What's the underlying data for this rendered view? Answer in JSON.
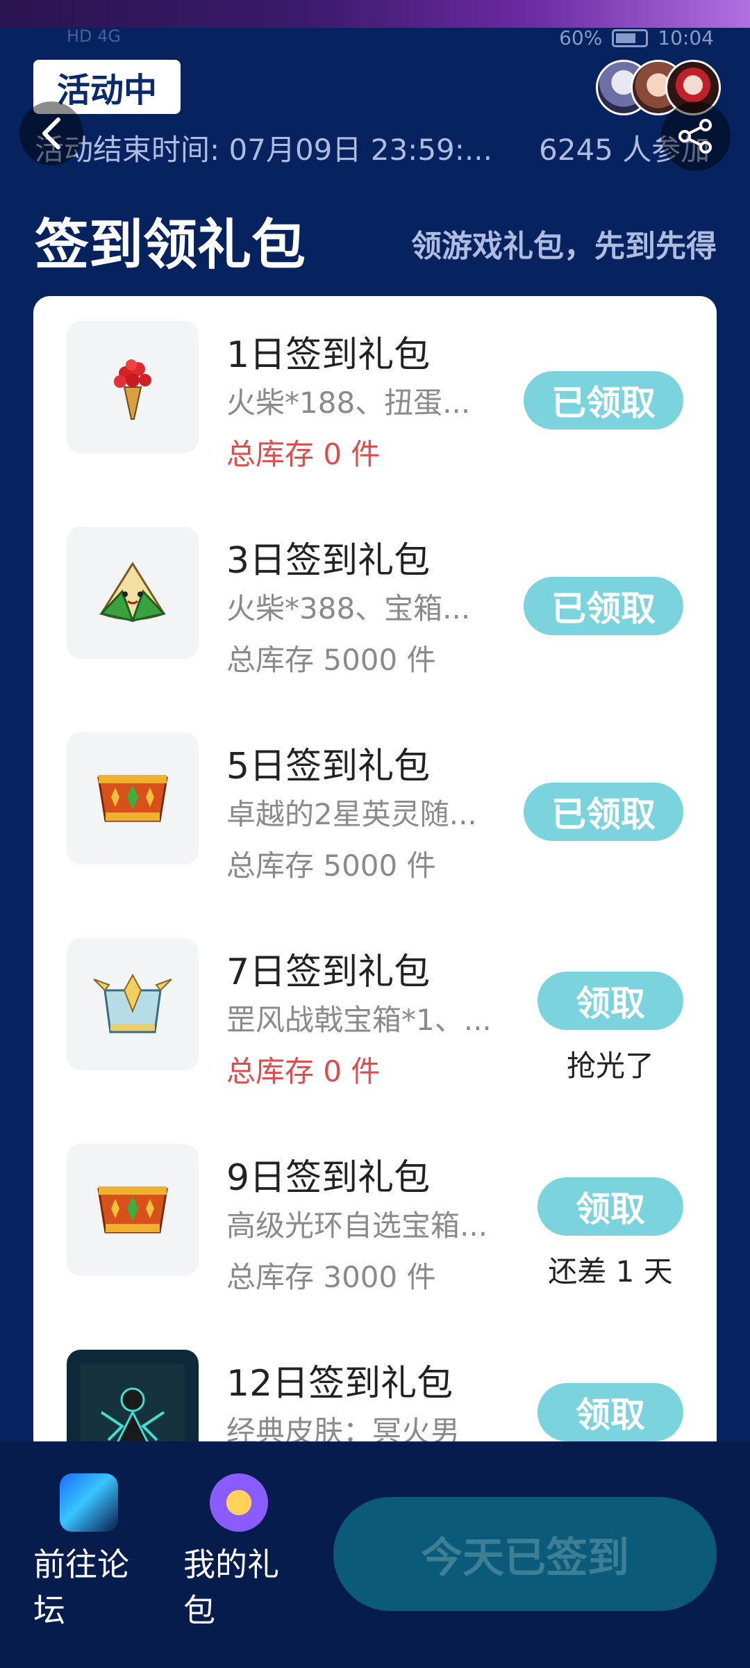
{
  "status_bar": {
    "left": "HD 4G",
    "battery": "60%",
    "time": "10:04"
  },
  "header": {
    "active_badge": "活动中",
    "end_time": "活动结束时间: 07月09日 23:59:...",
    "participants": "6245 人参加"
  },
  "section": {
    "title": "签到领礼包",
    "subtitle": "领游戏礼包，先到先得"
  },
  "gifts": [
    {
      "name": "1日签到礼包",
      "desc": "火柴*188、扭蛋...",
      "stock": "总库存 0 件",
      "button": "已领取"
    },
    {
      "name": "3日签到礼包",
      "desc": "火柴*388、宝箱...",
      "stock": "总库存 5000 件",
      "button": "已领取"
    },
    {
      "name": "5日签到礼包",
      "desc": "卓越的2星英灵随...",
      "stock": "总库存 5000 件",
      "button": "已领取"
    },
    {
      "name": "7日签到礼包",
      "desc": "罡风战戟宝箱*1、...",
      "stock": "总库存 0 件",
      "button": "领取",
      "note": "抢光了"
    },
    {
      "name": "9日签到礼包",
      "desc": "高级光环自选宝箱...",
      "stock": "总库存 3000 件",
      "button": "领取",
      "note": "还差 1 天"
    },
    {
      "name": "12日签到礼包",
      "desc": "经典皮肤：冥火男",
      "button": "领取"
    }
  ],
  "bottom": {
    "forum": "前往论坛",
    "my_gifts": "我的礼包",
    "signed": "今天已签到"
  }
}
